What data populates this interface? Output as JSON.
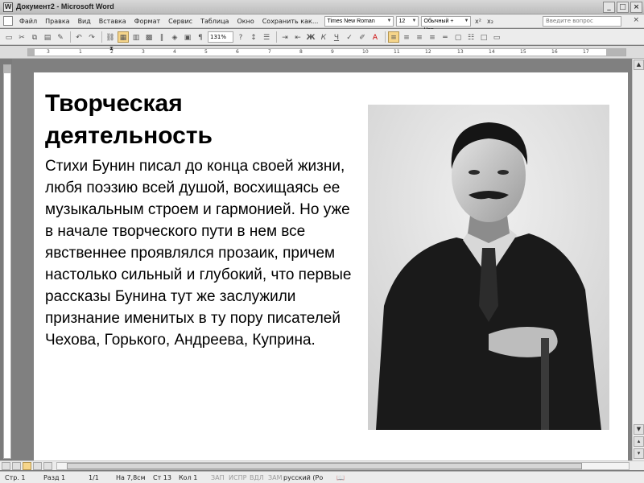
{
  "window": {
    "title": "Документ2 - Microsoft Word",
    "buttons": [
      "_",
      "□",
      "×"
    ]
  },
  "menu": {
    "items": [
      "Файл",
      "Правка",
      "Вид",
      "Вставка",
      "Формат",
      "Сервис",
      "Таблица",
      "Окно",
      "Сохранить как..."
    ],
    "font_name": "Times New Roman",
    "font_size": "12",
    "style": "Обычный + Чер",
    "help_placeholder": "Введите вопрос"
  },
  "toolbar": {
    "zoom": "131%"
  },
  "document": {
    "heading": "Творческая деятельность",
    "body": "Стихи Бунин писал до конца своей жизни, любя поэзию всей душой, восхищаясь ее музыкальным строем и гармонией. Но уже в начале творческого пути в нем все явственнее проявлялся прозаик, причем настолько сильный и глубокий, что первые рассказы Бунина тут же заслужили признание именитых в ту пору писателей Чехова, Горького, Андреева, Куприна."
  },
  "ruler": {
    "labels": [
      "3",
      "1",
      "2",
      "3",
      "4",
      "5",
      "6",
      "7",
      "8",
      "9",
      "10",
      "11",
      "12",
      "13",
      "14",
      "15",
      "16",
      "17"
    ]
  },
  "status": {
    "page": "Стр. 1",
    "section": "Разд 1",
    "pages": "1/1",
    "position": "На 7,8см",
    "line": "Ст 13",
    "column": "Кол 1",
    "rec": "ЗАП",
    "trk": "ИСПР",
    "ext": "ВДЛ",
    "ovr": "ЗАМ",
    "language": "русский (Ро"
  }
}
